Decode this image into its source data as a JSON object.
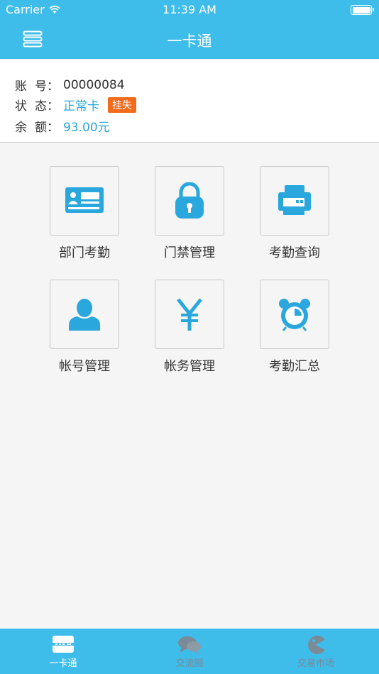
{
  "status_bar": {
    "carrier": "Carrier",
    "time": "11:39 AM"
  },
  "nav": {
    "title": "一卡通",
    "menu_icon": "menu-lines-icon"
  },
  "account": {
    "account_label_1": "账",
    "account_label_2": "号：",
    "account_value": "00000084",
    "status_label_1": "状",
    "status_label_2": "态：",
    "status_value": "正常卡",
    "report_loss": "挂失",
    "balance_label_1": "余",
    "balance_label_2": "额：",
    "balance_value": "93.00元"
  },
  "menu": [
    {
      "label": "部门考勤",
      "icon": "id-card-icon"
    },
    {
      "label": "门禁管理",
      "icon": "lock-icon"
    },
    {
      "label": "考勤查询",
      "icon": "printer-icon"
    },
    {
      "label": "帐号管理",
      "icon": "user-icon"
    },
    {
      "label": "帐务管理",
      "icon": "yen-icon"
    },
    {
      "label": "考勤汇总",
      "icon": "alarm-clock-icon"
    }
  ],
  "tabs": [
    {
      "label": "一卡通",
      "icon": "card-icon",
      "active": true
    },
    {
      "label": "交流圈",
      "icon": "chat-icon",
      "active": false
    },
    {
      "label": "交易市场",
      "icon": "pacman-icon",
      "active": false
    }
  ],
  "colors": {
    "primary": "#3ebcea",
    "accent_blue": "#2aa7dc",
    "badge_orange": "#f26b1d"
  }
}
